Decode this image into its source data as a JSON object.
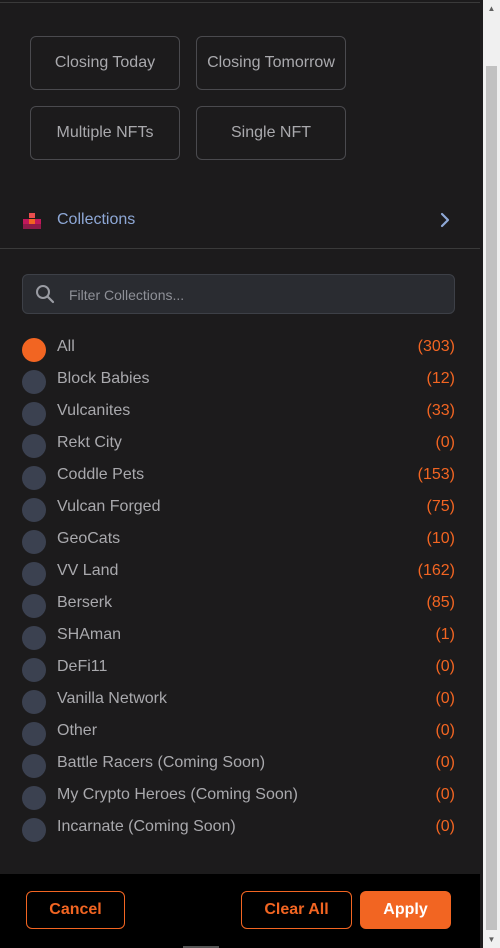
{
  "quick_filters": [
    {
      "label": "Closing Today"
    },
    {
      "label": "Closing Tomorrow"
    },
    {
      "label": "Multiple NFTs"
    },
    {
      "label": "Single NFT"
    }
  ],
  "collections_header": {
    "label": "Collections",
    "icon": "collections-icon",
    "chevron": "chevron-right-icon"
  },
  "search": {
    "placeholder": "Filter Collections...",
    "value": ""
  },
  "collections": [
    {
      "name": "All",
      "count": "(303)",
      "selected": true
    },
    {
      "name": "Block Babies",
      "count": "(12)",
      "selected": false
    },
    {
      "name": "Vulcanites",
      "count": "(33)",
      "selected": false
    },
    {
      "name": "Rekt City",
      "count": "(0)",
      "selected": false
    },
    {
      "name": "Coddle Pets",
      "count": "(153)",
      "selected": false
    },
    {
      "name": "Vulcan Forged",
      "count": "(75)",
      "selected": false
    },
    {
      "name": "GeoCats",
      "count": "(10)",
      "selected": false
    },
    {
      "name": "VV Land",
      "count": "(162)",
      "selected": false
    },
    {
      "name": "Berserk",
      "count": "(85)",
      "selected": false
    },
    {
      "name": "SHAman",
      "count": "(1)",
      "selected": false
    },
    {
      "name": "DeFi11",
      "count": "(0)",
      "selected": false
    },
    {
      "name": "Vanilla Network",
      "count": "(0)",
      "selected": false
    },
    {
      "name": "Other",
      "count": "(0)",
      "selected": false
    },
    {
      "name": "Battle Racers (Coming Soon)",
      "count": "(0)",
      "selected": false
    },
    {
      "name": "My Crypto Heroes (Coming Soon)",
      "count": "(0)",
      "selected": false
    },
    {
      "name": "Incarnate (Coming Soon)",
      "count": "(0)",
      "selected": false
    }
  ],
  "footer": {
    "cancel_label": "Cancel",
    "clear_label": "Clear All",
    "apply_label": "Apply"
  },
  "colors": {
    "accent": "#f26522",
    "background": "#1c1b1c",
    "radio_unselected": "#3b4150",
    "collections_label": "#8ea8d6"
  }
}
